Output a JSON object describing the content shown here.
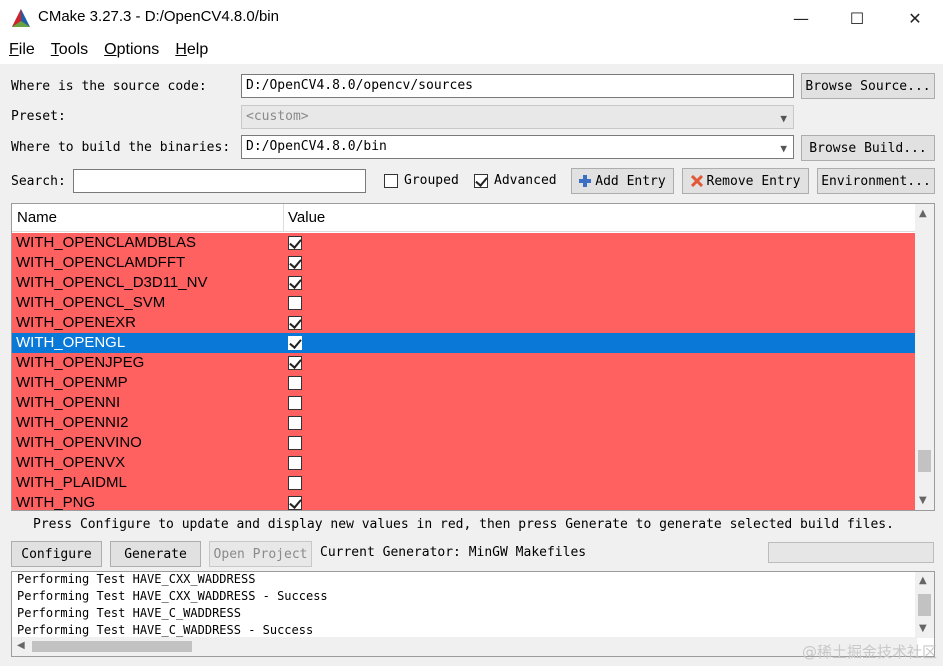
{
  "window": {
    "title": "CMake 3.27.3 - D:/OpenCV4.8.0/bin",
    "minimize": "—",
    "maximize": "☐",
    "close": "✕"
  },
  "menu": {
    "file": {
      "accel": "F",
      "rest": "ile"
    },
    "tools": {
      "accel": "T",
      "rest": "ools"
    },
    "options": {
      "accel": "O",
      "rest": "ptions"
    },
    "help": {
      "accel": "H",
      "rest": "elp"
    }
  },
  "source": {
    "label": "Where is the source code:",
    "value": "D:/OpenCV4.8.0/opencv/sources",
    "browse": "Browse Source..."
  },
  "preset": {
    "label": "Preset:",
    "value": "<custom>"
  },
  "build": {
    "label": "Where to build the binaries:",
    "value": "D:/OpenCV4.8.0/bin",
    "browse": "Browse Build..."
  },
  "search": {
    "label": "Search:",
    "value": "",
    "grouped_label": "Grouped",
    "grouped_checked": false,
    "advanced_label": "Advanced",
    "advanced_checked": true,
    "add_entry": "Add Entry",
    "remove_entry": "Remove Entry",
    "environment": "Environment..."
  },
  "table": {
    "col_name": "Name",
    "col_value": "Value",
    "rows": [
      {
        "name": "WITH_OPENCLAMDBLAS",
        "checked": true,
        "selected": false
      },
      {
        "name": "WITH_OPENCLAMDFFT",
        "checked": true,
        "selected": false
      },
      {
        "name": "WITH_OPENCL_D3D11_NV",
        "checked": true,
        "selected": false
      },
      {
        "name": "WITH_OPENCL_SVM",
        "checked": false,
        "selected": false
      },
      {
        "name": "WITH_OPENEXR",
        "checked": true,
        "selected": false
      },
      {
        "name": "WITH_OPENGL",
        "checked": true,
        "selected": true
      },
      {
        "name": "WITH_OPENJPEG",
        "checked": true,
        "selected": false
      },
      {
        "name": "WITH_OPENMP",
        "checked": false,
        "selected": false
      },
      {
        "name": "WITH_OPENNI",
        "checked": false,
        "selected": false
      },
      {
        "name": "WITH_OPENNI2",
        "checked": false,
        "selected": false
      },
      {
        "name": "WITH_OPENVINO",
        "checked": false,
        "selected": false
      },
      {
        "name": "WITH_OPENVX",
        "checked": false,
        "selected": false
      },
      {
        "name": "WITH_PLAIDML",
        "checked": false,
        "selected": false
      },
      {
        "name": "WITH_PNG",
        "checked": true,
        "selected": false
      }
    ]
  },
  "hint": "Press Configure to update and display new values in red, then press Generate to generate selected build files.",
  "actions": {
    "configure": "Configure",
    "generate": "Generate",
    "open_project": "Open Project",
    "current_generator": "Current Generator: MinGW Makefiles"
  },
  "log": [
    "Performing Test HAVE_CXX_WADDRESS",
    "Performing Test HAVE_CXX_WADDRESS - Success",
    "Performing Test HAVE_C_WADDRESS",
    "Performing Test HAVE_C_WADDRESS - Success"
  ],
  "watermark": "@稀土掘金技术社区",
  "colors": {
    "changed_row": "#ff6060",
    "selected_row": "#0a78d7"
  }
}
